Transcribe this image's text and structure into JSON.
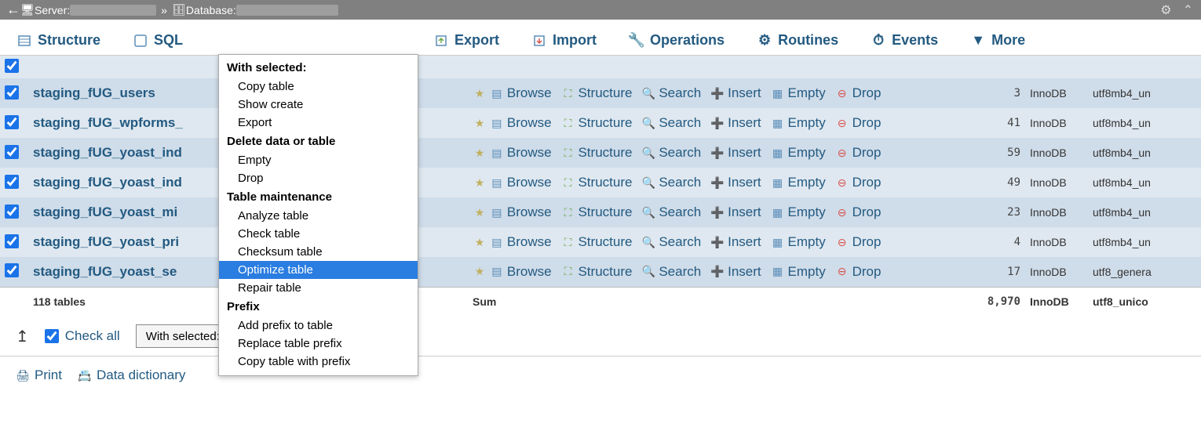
{
  "breadcrumb": {
    "server_label": "Server:",
    "database_label": "Database:"
  },
  "tabs": {
    "structure": "Structure",
    "sql": "SQL",
    "export": "Export",
    "import": "Import",
    "operations": "Operations",
    "routines": "Routines",
    "events": "Events",
    "more": "More"
  },
  "action_labels": {
    "browse": "Browse",
    "structure": "Structure",
    "search": "Search",
    "insert": "Insert",
    "empty": "Empty",
    "drop": "Drop"
  },
  "rows": [
    {
      "name": "staging_fUG_users",
      "count": "3",
      "engine": "InnoDB",
      "collation": "utf8mb4_un"
    },
    {
      "name": "staging_fUG_wpforms_",
      "count": "41",
      "engine": "InnoDB",
      "collation": "utf8mb4_un"
    },
    {
      "name": "staging_fUG_yoast_ind",
      "count": "59",
      "engine": "InnoDB",
      "collation": "utf8mb4_un"
    },
    {
      "name": "staging_fUG_yoast_ind",
      "count": "49",
      "engine": "InnoDB",
      "collation": "utf8mb4_un"
    },
    {
      "name": "staging_fUG_yoast_mi",
      "count": "23",
      "engine": "InnoDB",
      "collation": "utf8mb4_un"
    },
    {
      "name": "staging_fUG_yoast_pri",
      "count": "4",
      "engine": "InnoDB",
      "collation": "utf8mb4_un"
    },
    {
      "name": "staging_fUG_yoast_se",
      "count": "17",
      "engine": "InnoDB",
      "collation": "utf8_genera"
    }
  ],
  "summary": {
    "tables_label": "118 tables",
    "sum_label": "Sum",
    "sum_count": "8,970",
    "sum_engine": "InnoDB",
    "sum_collation": "utf8_unico"
  },
  "footer": {
    "check_all": "Check all",
    "with_selected": "With selected:",
    "print": "Print",
    "data_dictionary": "Data dictionary"
  },
  "menu": {
    "with_selected_hdr": "With selected:",
    "copy_table": "Copy table",
    "show_create": "Show create",
    "export": "Export",
    "delete_hdr": "Delete data or table",
    "empty": "Empty",
    "drop": "Drop",
    "maint_hdr": "Table maintenance",
    "analyze": "Analyze table",
    "check": "Check table",
    "checksum": "Checksum table",
    "optimize": "Optimize table",
    "repair": "Repair table",
    "prefix_hdr": "Prefix",
    "add_prefix": "Add prefix to table",
    "replace_prefix": "Replace table prefix",
    "copy_prefix": "Copy table with prefix"
  }
}
